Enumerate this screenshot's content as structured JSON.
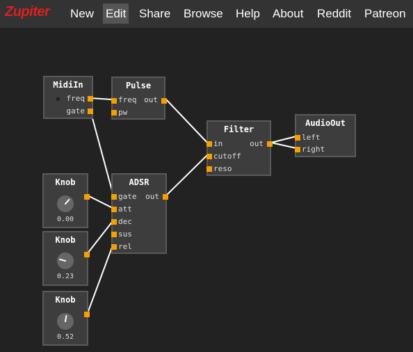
{
  "app": {
    "logo": "Zupiter"
  },
  "menu": {
    "new": "New",
    "edit": "Edit",
    "share": "Share",
    "browse": "Browse",
    "help": "Help",
    "about": "About",
    "reddit": "Reddit",
    "patreon": "Patreon"
  },
  "nodes": {
    "midiin": {
      "title": "MidiIn",
      "ports": {
        "freq": "freq",
        "gate": "gate"
      }
    },
    "pulse": {
      "title": "Pulse",
      "ports": {
        "freq": "freq",
        "pw": "pw",
        "out": "out"
      }
    },
    "filter": {
      "title": "Filter",
      "ports": {
        "in": "in",
        "cutoff": "cutoff",
        "reso": "reso",
        "out": "out"
      }
    },
    "audioout": {
      "title": "AudioOut",
      "ports": {
        "left": "left",
        "right": "right"
      }
    },
    "adsr": {
      "title": "ADSR",
      "ports": {
        "gate": "gate",
        "att": "att",
        "dec": "dec",
        "sus": "sus",
        "rel": "rel",
        "out": "out"
      }
    },
    "knob1": {
      "title": "Knob",
      "value": "0.00"
    },
    "knob2": {
      "title": "Knob",
      "value": "0.23"
    },
    "knob3": {
      "title": "Knob",
      "value": "0.52"
    }
  },
  "colors": {
    "port": "#f5a000",
    "wire": "#ffffff",
    "logo": "#dd2020"
  }
}
